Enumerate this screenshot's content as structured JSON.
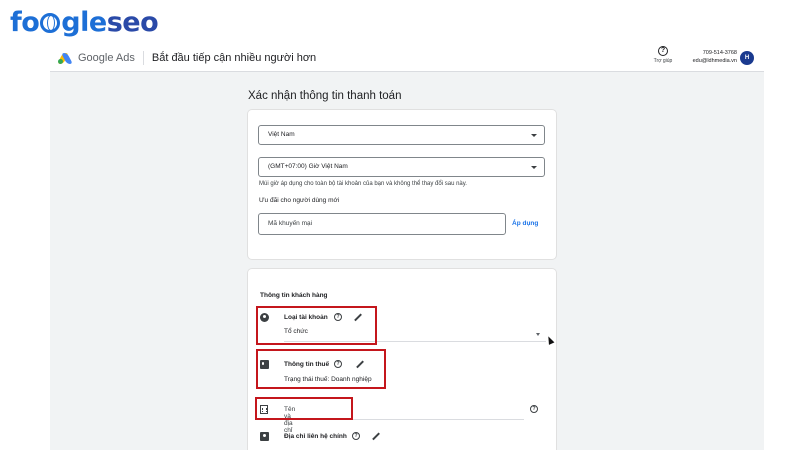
{
  "watermark": {
    "text_part1": "fo",
    "text_part2": "gle",
    "text_part3": "seo"
  },
  "header": {
    "brand": "Google Ads",
    "page_heading": "Bắt đầu tiếp cận nhiều người hơn",
    "help_label": "Trợ giúp",
    "account_id": "709-514-3768",
    "account_email": "edu@ldhmedia.vn",
    "avatar_initial": "H"
  },
  "section_title": "Xác nhận thông tin thanh toán",
  "billing": {
    "country_select": "Việt Nam",
    "timezone_select": "(GMT+07:00) Giờ Việt Nam",
    "timezone_hint": "Múi giờ áp dụng cho toàn bộ tài khoản của bạn và không thể thay đổi sau này.",
    "promo_label": "Ưu đãi cho người dùng mới",
    "promo_placeholder": "Mã khuyến mại",
    "apply_label": "Áp dụng"
  },
  "customer": {
    "title": "Thông tin khách hàng",
    "account_type_label": "Loại tài khoản",
    "account_type_value": "Tổ chức",
    "tax_label": "Thông tin thuế",
    "tax_value": "Trạng thái thuế: Doanh nghiệp",
    "name_address_placeholder": "Tên và địa chỉ",
    "contact_label": "Địa chỉ liên hệ chính"
  },
  "colors": {
    "highlight": "#c4161c",
    "link": "#1a73e8",
    "brand_blue": "#1d6fd6"
  }
}
